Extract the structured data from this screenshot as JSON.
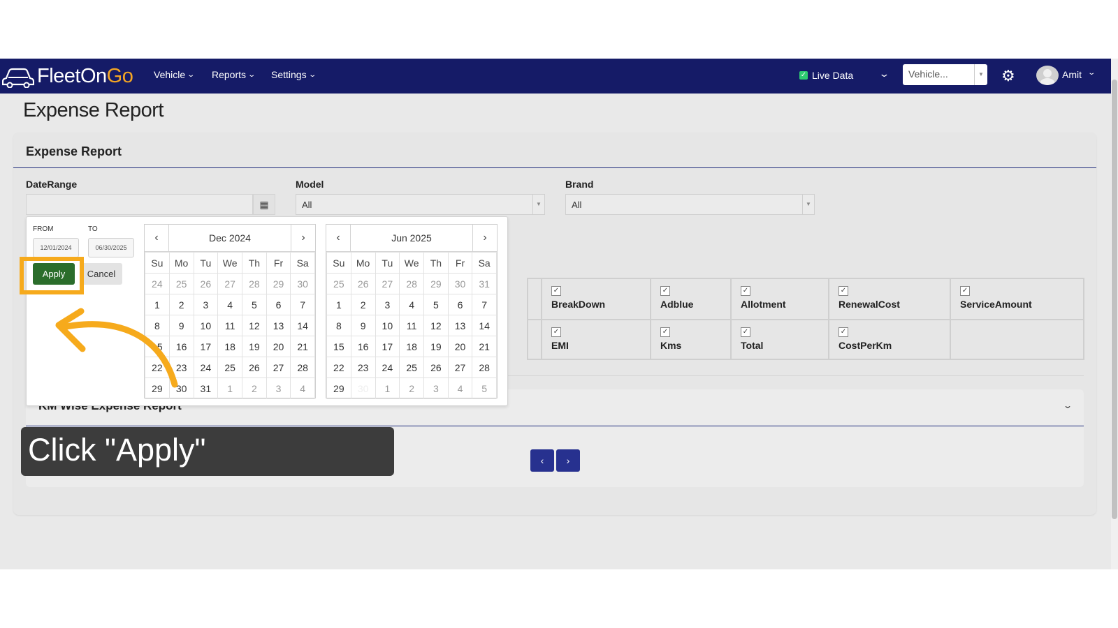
{
  "brand": {
    "logo_part1": "FleetOn",
    "logo_part2": "Go",
    "accent": "#f5a623",
    "nav_bg": "#151b67"
  },
  "nav": {
    "vehicle": "Vehicle",
    "reports": "Reports",
    "settings": "Settings"
  },
  "header_right": {
    "live_data": "Live Data",
    "vehicle_select": "Vehicle...",
    "user": "Amit"
  },
  "page_title": "Expense Report",
  "card": {
    "title": "Expense Report"
  },
  "filters": {
    "date_range_label": "DateRange",
    "model_label": "Model",
    "model_value": "All",
    "brand_label": "Brand",
    "brand_value": "All"
  },
  "picker": {
    "from_label": "FROM",
    "to_label": "TO",
    "from_value": "12/01/2024",
    "to_value": "06/30/2025",
    "apply": "Apply",
    "cancel": "Cancel",
    "weekdays": [
      "Su",
      "Mo",
      "Tu",
      "We",
      "Th",
      "Fr",
      "Sa"
    ],
    "left": {
      "month": "Dec 2024",
      "weeks": [
        [
          "24",
          "25",
          "26",
          "27",
          "28",
          "29",
          "30"
        ],
        [
          "1",
          "2",
          "3",
          "4",
          "5",
          "6",
          "7"
        ],
        [
          "8",
          "9",
          "10",
          "11",
          "12",
          "13",
          "14"
        ],
        [
          "15",
          "16",
          "17",
          "18",
          "19",
          "20",
          "21"
        ],
        [
          "22",
          "23",
          "24",
          "25",
          "26",
          "27",
          "28"
        ],
        [
          "29",
          "30",
          "31",
          "1",
          "2",
          "3",
          "4"
        ]
      ]
    },
    "right": {
      "month": "Jun 2025",
      "weeks": [
        [
          "25",
          "26",
          "27",
          "28",
          "29",
          "30",
          "31"
        ],
        [
          "1",
          "2",
          "3",
          "4",
          "5",
          "6",
          "7"
        ],
        [
          "8",
          "9",
          "10",
          "11",
          "12",
          "13",
          "14"
        ],
        [
          "15",
          "16",
          "17",
          "18",
          "19",
          "20",
          "21"
        ],
        [
          "22",
          "23",
          "24",
          "25",
          "26",
          "27",
          "28"
        ],
        [
          "29",
          "30",
          "1",
          "2",
          "3",
          "4",
          "5"
        ]
      ]
    }
  },
  "columns": {
    "row1": [
      "BreakDown",
      "Adblue",
      "Allotment",
      "RenewalCost",
      "ServiceAmount"
    ],
    "row2": [
      "EMI",
      "Kms",
      "Total",
      "CostPerKm"
    ]
  },
  "km_section": {
    "title": "KM Wise Expense Report"
  },
  "pagination": {
    "prev": "‹",
    "next": "›"
  },
  "tooltip": {
    "text": "Click \"Apply\""
  }
}
